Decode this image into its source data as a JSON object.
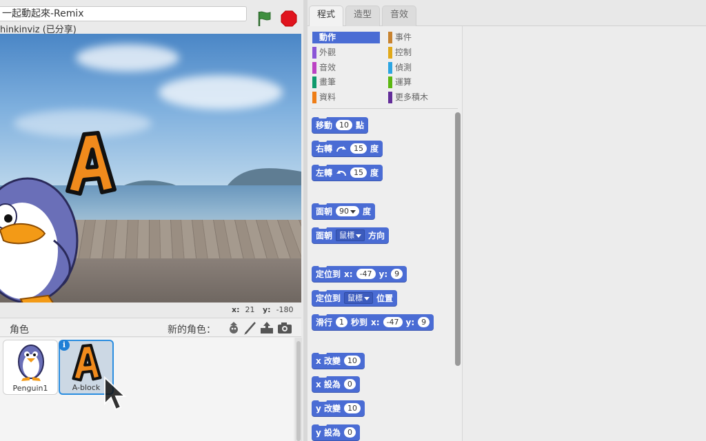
{
  "project": {
    "title": "一起動起來-Remix",
    "owner_line": "hinkinviz (已分享)"
  },
  "stage": {
    "x_label": "x:",
    "x_value": "21",
    "y_label": "y:",
    "y_value": "-180"
  },
  "sprites_panel": {
    "label": "角色",
    "new_sprite_label": "新的角色：",
    "sprites": [
      {
        "name": "Penguin1",
        "selected": false
      },
      {
        "name": "A-block",
        "selected": true
      }
    ]
  },
  "tabs": [
    {
      "label": "程式",
      "active": true
    },
    {
      "label": "造型",
      "active": false
    },
    {
      "label": "音效",
      "active": false
    }
  ],
  "categories": [
    {
      "label": "動作",
      "color": "#4a6cd4",
      "selected": true
    },
    {
      "label": "事件",
      "color": "#c88330"
    },
    {
      "label": "外觀",
      "color": "#8a55d7"
    },
    {
      "label": "控制",
      "color": "#e1a91a"
    },
    {
      "label": "音效",
      "color": "#bb42c3"
    },
    {
      "label": "偵測",
      "color": "#2ca5e2"
    },
    {
      "label": "畫筆",
      "color": "#0e9a6c"
    },
    {
      "label": "運算",
      "color": "#5cb712"
    },
    {
      "label": "資料",
      "color": "#ee7d16"
    },
    {
      "label": "更多積木",
      "color": "#632d99"
    }
  ],
  "blocks": {
    "move": {
      "a": "移動",
      "n": "10",
      "b": "點"
    },
    "turn_right": {
      "a": "右轉",
      "n": "15",
      "b": "度"
    },
    "turn_left": {
      "a": "左轉",
      "n": "15",
      "b": "度"
    },
    "point_dir": {
      "a": "面朝",
      "n": "90",
      "b": "度"
    },
    "point_towards": {
      "a": "面朝",
      "dd": "鼠標",
      "b": "方向"
    },
    "goto_xy": {
      "a": "定位到",
      "xl": "x:",
      "x": "-47",
      "yl": "y:",
      "y": "9"
    },
    "goto": {
      "a": "定位到",
      "dd": "鼠標",
      "b": "位置"
    },
    "glide": {
      "a": "滑行",
      "n": "1",
      "b": "秒到",
      "xl": "x:",
      "x": "-47",
      "yl": "y:",
      "y": "9"
    },
    "change_x": {
      "a": "x 改變",
      "n": "10"
    },
    "set_x": {
      "a": "x 設為",
      "n": "0"
    },
    "change_y": {
      "a": "y 改變",
      "n": "10"
    },
    "set_y": {
      "a": "y 設為",
      "n": "0"
    }
  }
}
